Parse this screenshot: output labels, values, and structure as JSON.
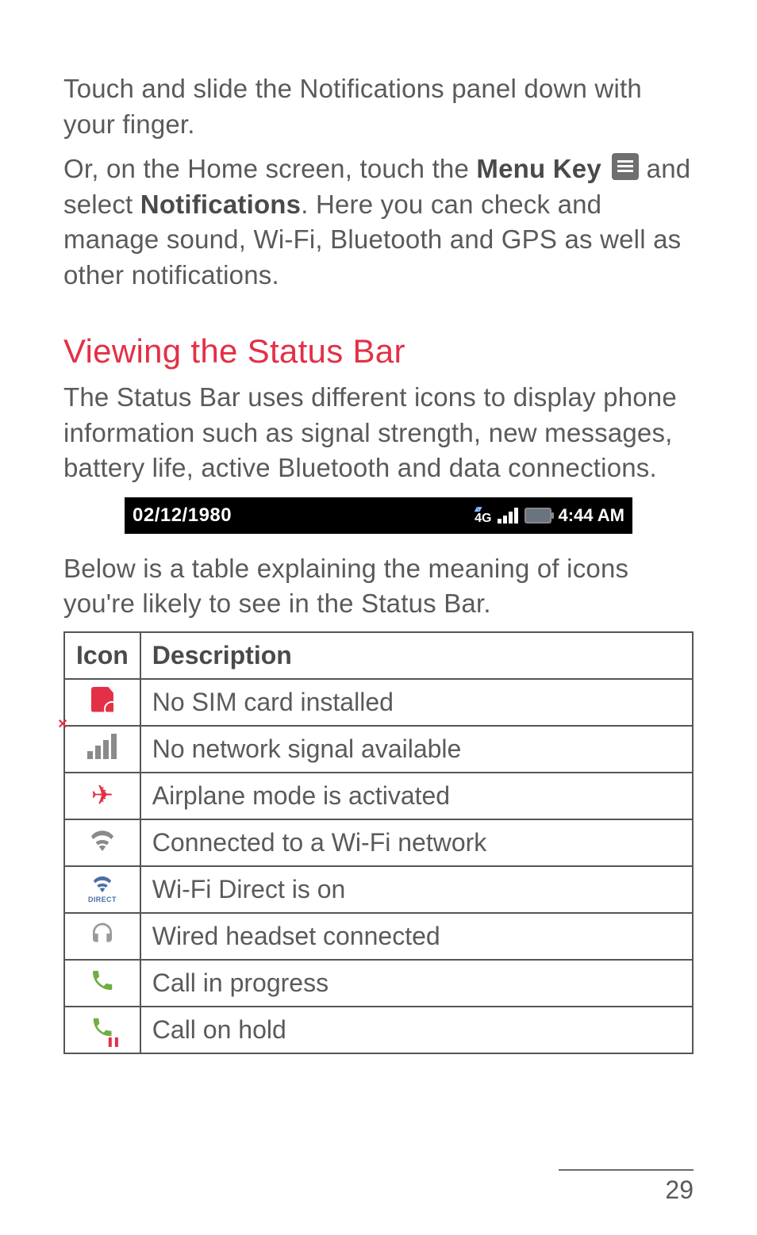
{
  "intro": {
    "para1": "Touch and slide the Notifications panel down with your finger.",
    "para2_prefix": "Or, on the Home screen, touch the ",
    "para2_bold1": "Menu Key",
    "para2_mid": " and select ",
    "para2_bold2": "Notifications",
    "para2_suffix": ". Here you can check and manage sound, Wi-Fi, Bluetooth and GPS as well as other notifications."
  },
  "section_title": "Viewing the Status Bar",
  "section_intro": "The Status Bar uses different icons to display phone information such as signal strength, new messages, battery life, active Bluetooth and data connections.",
  "statusbar": {
    "date": "02/12/1980",
    "nettype": "4G",
    "time": "4:44 AM"
  },
  "table_intro": "Below is a table explaining the meaning of icons you're likely to see in the Status Bar.",
  "table": {
    "header_icon": "Icon",
    "header_desc": "Description",
    "rows": [
      {
        "icon": "no-sim-icon",
        "desc": "No SIM card installed"
      },
      {
        "icon": "no-signal-icon",
        "desc": "No network signal available"
      },
      {
        "icon": "airplane-icon",
        "desc": "Airplane mode is activated"
      },
      {
        "icon": "wifi-icon",
        "desc": "Connected to a Wi-Fi network"
      },
      {
        "icon": "wifi-direct-icon",
        "desc": "Wi-Fi Direct is on"
      },
      {
        "icon": "headset-icon",
        "desc": "Wired headset connected"
      },
      {
        "icon": "call-icon",
        "desc": "Call in progress"
      },
      {
        "icon": "call-hold-icon",
        "desc": "Call on hold"
      }
    ]
  },
  "wifi_direct_label": "DIRECT",
  "page_number": "29"
}
